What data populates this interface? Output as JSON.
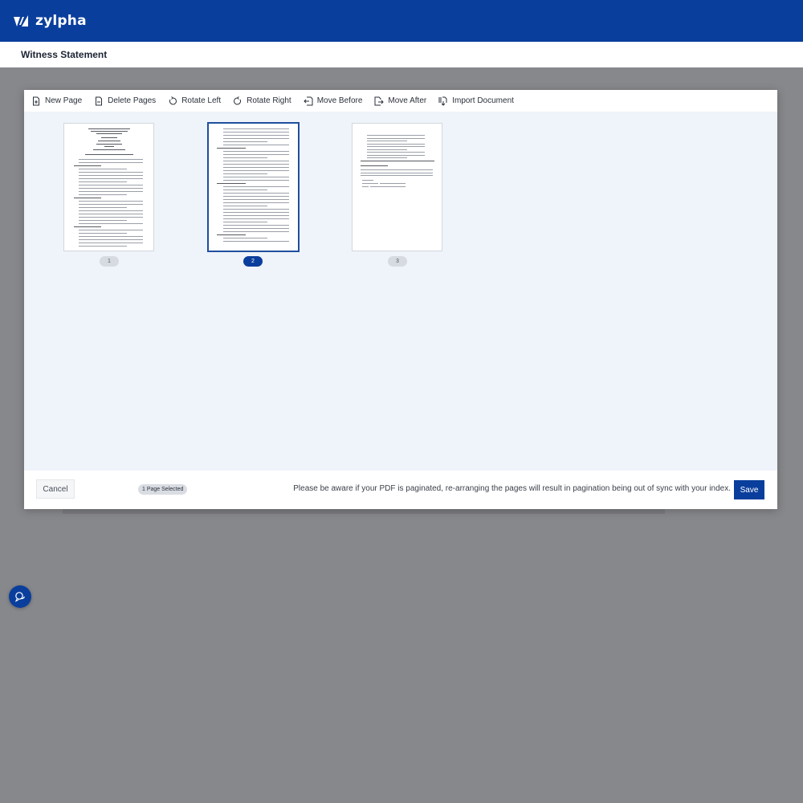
{
  "app": {
    "brand": "zylpha",
    "page_title": "Witness Statement"
  },
  "toolbar": {
    "items": [
      {
        "label": "New Page",
        "icon": "new-page-icon"
      },
      {
        "label": "Delete Pages",
        "icon": "delete-pages-icon"
      },
      {
        "label": "Rotate Left",
        "icon": "rotate-left-icon"
      },
      {
        "label": "Rotate Right",
        "icon": "rotate-right-icon"
      },
      {
        "label": "Move Before",
        "icon": "move-before-icon"
      },
      {
        "label": "Move After",
        "icon": "move-after-icon"
      },
      {
        "label": "Import Document",
        "icon": "import-document-icon"
      }
    ]
  },
  "pages": [
    {
      "number": "1",
      "selected": false
    },
    {
      "number": "2",
      "selected": true
    },
    {
      "number": "3",
      "selected": false
    }
  ],
  "footer": {
    "cancel_label": "Cancel",
    "selection_badge": "1 Page Selected",
    "notice": "Please be aware if your PDF is paginated, re-arranging the pages will result in pagination being out of sync with your index.",
    "save_label": "Save"
  },
  "colors": {
    "brand": "#0a3e9c",
    "backdrop": "#87888c",
    "canvas": "#eff3fa"
  }
}
